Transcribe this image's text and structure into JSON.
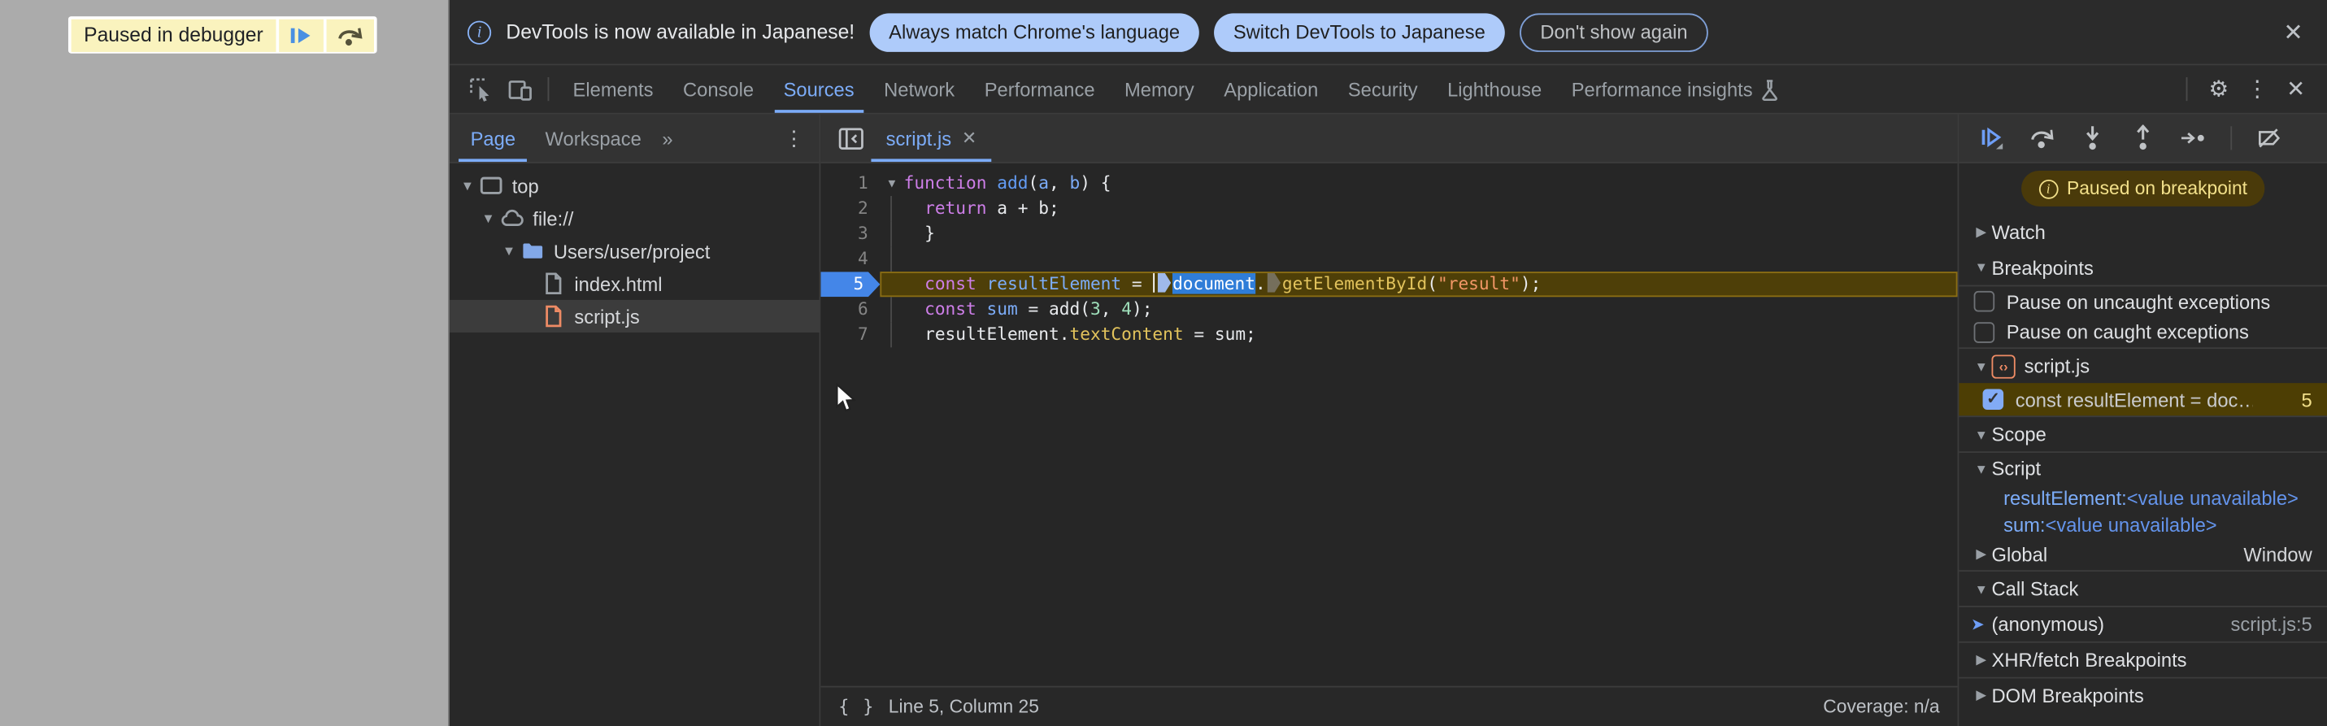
{
  "colors": {
    "accent_blue": "#7cacf8",
    "pill_blue": "#aecbfa",
    "paused_yellow_bg": "#4a3a0a",
    "paused_yellow_text": "#f2e08a",
    "exec_line_bg": "#4e3f08",
    "breakpoint_badge": "#4486e8",
    "page_dim_gray": "#ababab",
    "overlay_yellow": "#faf3be",
    "selection_blue": "#2f7dd8",
    "keyword": "#cd7ee8",
    "string": "#f29766",
    "property": "#e2c35c",
    "number": "#9fe0bb"
  },
  "page_overlay": {
    "message": "Paused in debugger"
  },
  "infobar": {
    "message": "DevTools is now available in Japanese!",
    "btn_match": "Always match Chrome's language",
    "btn_switch": "Switch DevTools to Japanese",
    "btn_dismiss": "Don't show again",
    "close": "✕"
  },
  "tabbar": {
    "tabs": [
      "Elements",
      "Console",
      "Sources",
      "Network",
      "Performance",
      "Memory",
      "Application",
      "Security",
      "Lighthouse",
      "Performance insights"
    ],
    "active": "Sources",
    "more_glyph": "⋮",
    "close_glyph": "✕"
  },
  "sidebar_left": {
    "tabs": {
      "page": "Page",
      "workspace": "Workspace",
      "overflow": "»",
      "menu": "⋮"
    },
    "tree": {
      "top": "top",
      "file_scheme": "file://",
      "folder": "Users/user/project",
      "file_html": "index.html",
      "file_js": "script.js"
    }
  },
  "editor": {
    "tab": {
      "name": "script.js",
      "close": "✕"
    },
    "code": {
      "lines": [
        {
          "no": 1,
          "fold": true,
          "tokens": [
            {
              "t": "function ",
              "c": "k"
            },
            {
              "t": "add",
              "c": "f"
            },
            {
              "t": "(",
              "c": "t"
            },
            {
              "t": "a",
              "c": "d"
            },
            {
              "t": ", ",
              "c": "t"
            },
            {
              "t": "b",
              "c": "d"
            },
            {
              "t": ") {",
              "c": "t"
            }
          ]
        },
        {
          "no": 2,
          "guide": true,
          "tokens": [
            {
              "t": "  ",
              "c": "t"
            },
            {
              "t": "return",
              "c": "k"
            },
            {
              "t": " a + b;",
              "c": "t"
            }
          ]
        },
        {
          "no": 3,
          "guide": true,
          "tokens": [
            {
              "t": "  }",
              "c": "t"
            }
          ]
        },
        {
          "no": 4,
          "guide": true,
          "tokens": []
        },
        {
          "no": 5,
          "bp": true,
          "active": true,
          "tokens": [
            {
              "t": "  ",
              "c": "t"
            },
            {
              "t": "const",
              "c": "k"
            },
            {
              "t": " ",
              "c": "t"
            },
            {
              "t": "resultElement",
              "c": "d"
            },
            {
              "t": " = ",
              "c": "t"
            },
            {
              "caret": true
            },
            {
              "marker": "blue"
            },
            {
              "t": "document",
              "c": "t",
              "sel": true
            },
            {
              "t": ".",
              "c": "t"
            },
            {
              "marker": "gray"
            },
            {
              "t": "getElementById",
              "c": "p"
            },
            {
              "t": "(",
              "c": "t"
            },
            {
              "t": "\"result\"",
              "c": "s"
            },
            {
              "t": ");",
              "c": "t"
            }
          ]
        },
        {
          "no": 6,
          "guide": true,
          "tokens": [
            {
              "t": "  ",
              "c": "t"
            },
            {
              "t": "const",
              "c": "k"
            },
            {
              "t": " ",
              "c": "t"
            },
            {
              "t": "sum",
              "c": "d"
            },
            {
              "t": " = add(",
              "c": "t"
            },
            {
              "t": "3",
              "c": "n"
            },
            {
              "t": ", ",
              "c": "t"
            },
            {
              "t": "4",
              "c": "n"
            },
            {
              "t": ");",
              "c": "t"
            }
          ]
        },
        {
          "no": 7,
          "guide": true,
          "tokens": [
            {
              "t": "  ",
              "c": "t"
            },
            {
              "t": "resultElement",
              "c": "t"
            },
            {
              "t": ".",
              "c": "t"
            },
            {
              "t": "textContent",
              "c": "p"
            },
            {
              "t": " = sum;",
              "c": "t"
            }
          ]
        }
      ]
    },
    "statusbar": {
      "icon": "{ }",
      "position": "Line 5, Column 25",
      "coverage": "Coverage: n/a"
    }
  },
  "sidebar_right": {
    "paused_banner": "Paused on breakpoint",
    "watch": {
      "label": "Watch"
    },
    "breakpoints": {
      "label": "Breakpoints",
      "cb_uncaught": "Pause on uncaught exceptions",
      "cb_caught": "Pause on caught exceptions",
      "group_file": "script.js",
      "entry": {
        "label": "const resultElement = doc…",
        "line": "5",
        "checked": true
      }
    },
    "scope": {
      "label": "Scope",
      "script_group": "Script",
      "var1_name": "resultElement",
      "var1_sep": ": ",
      "var1_value": "<value unavailable>",
      "var2_name": "sum",
      "var2_sep": ": ",
      "var2_value": "<value unavailable>",
      "global_label": "Global",
      "global_value": "Window"
    },
    "call_stack": {
      "label": "Call Stack",
      "frame": {
        "name": "(anonymous)",
        "location": "script.js:5"
      }
    },
    "xhr_breakpoints": {
      "label": "XHR/fetch Breakpoints"
    },
    "dom_breakpoints": {
      "label": "DOM Breakpoints"
    }
  }
}
